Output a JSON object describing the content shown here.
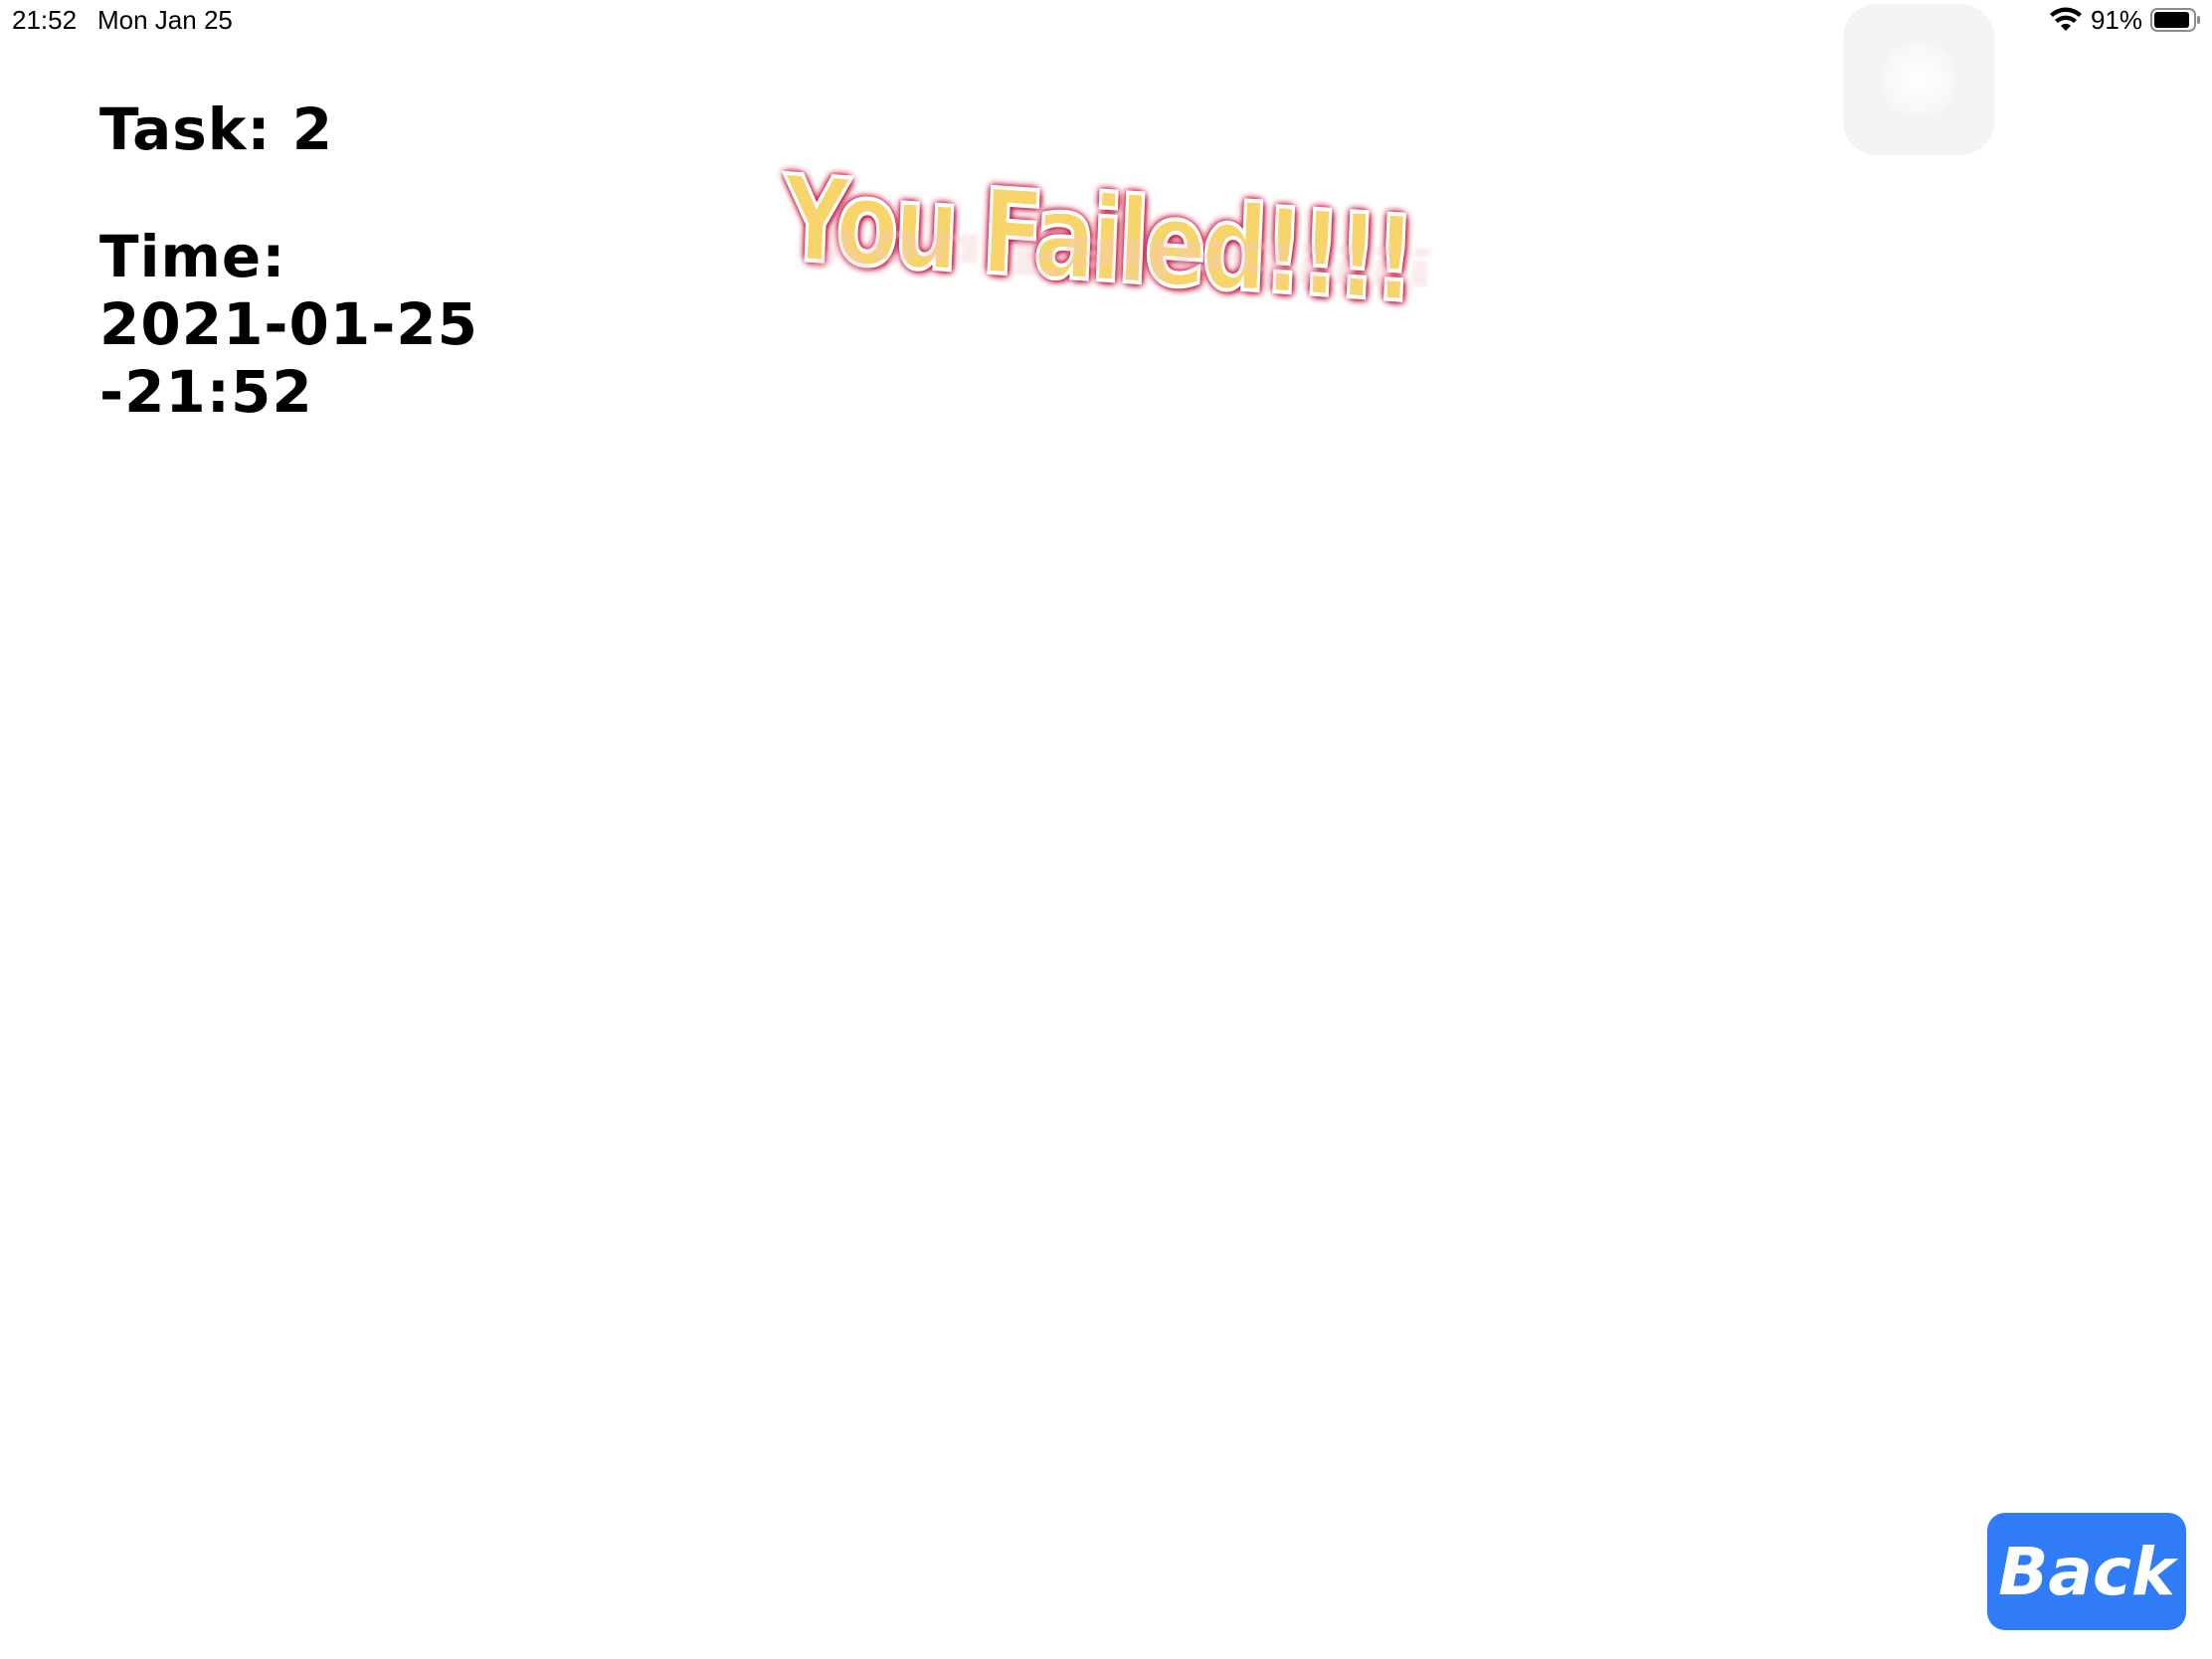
{
  "status_bar": {
    "time": "21:52",
    "date": "Mon Jan 25",
    "battery_percent": "91%",
    "battery_level": 0.91,
    "wifi_icon": "wifi-icon",
    "battery_icon": "battery-icon"
  },
  "task": {
    "label": "Task: 2"
  },
  "time": {
    "label": "Time:",
    "date": "2021-01-25",
    "clock": "-21:52"
  },
  "banner": {
    "text": "You Failed!!!!"
  },
  "actions": {
    "back_label": "Back"
  },
  "colors": {
    "back_button": "#2f7cf6",
    "banner_fill": "#f7d56b",
    "banner_glow": "#c8103a"
  }
}
